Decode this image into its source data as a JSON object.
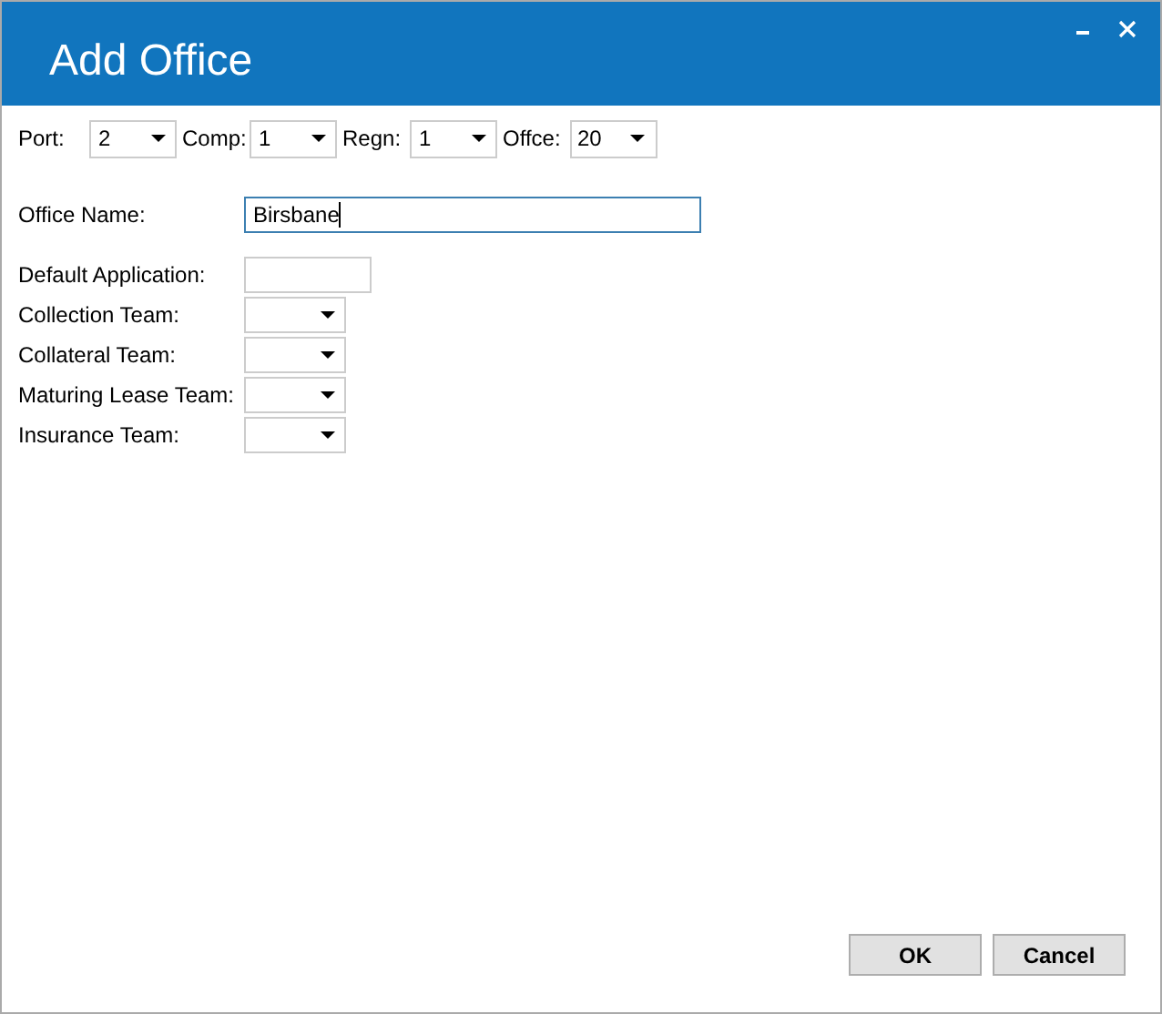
{
  "window": {
    "title": "Add Office"
  },
  "selectors": [
    {
      "label": "Port:",
      "value": "2"
    },
    {
      "label": "Comp:",
      "value": "1"
    },
    {
      "label": "Regn:",
      "value": "1"
    },
    {
      "label": "Offce:",
      "value": "20"
    }
  ],
  "office_name": {
    "label": "Office Name:",
    "value": "Birsbane",
    "focused": true
  },
  "fields": [
    {
      "label": "Default Application:",
      "kind": "text"
    },
    {
      "label": "Collection Team:",
      "kind": "dropdown"
    },
    {
      "label": "Collateral Team:",
      "kind": "dropdown"
    },
    {
      "label": "Maturing Lease Team:",
      "kind": "dropdown"
    },
    {
      "label": "Insurance Team:",
      "kind": "dropdown"
    }
  ],
  "buttons": [
    "OK",
    "Cancel"
  ]
}
